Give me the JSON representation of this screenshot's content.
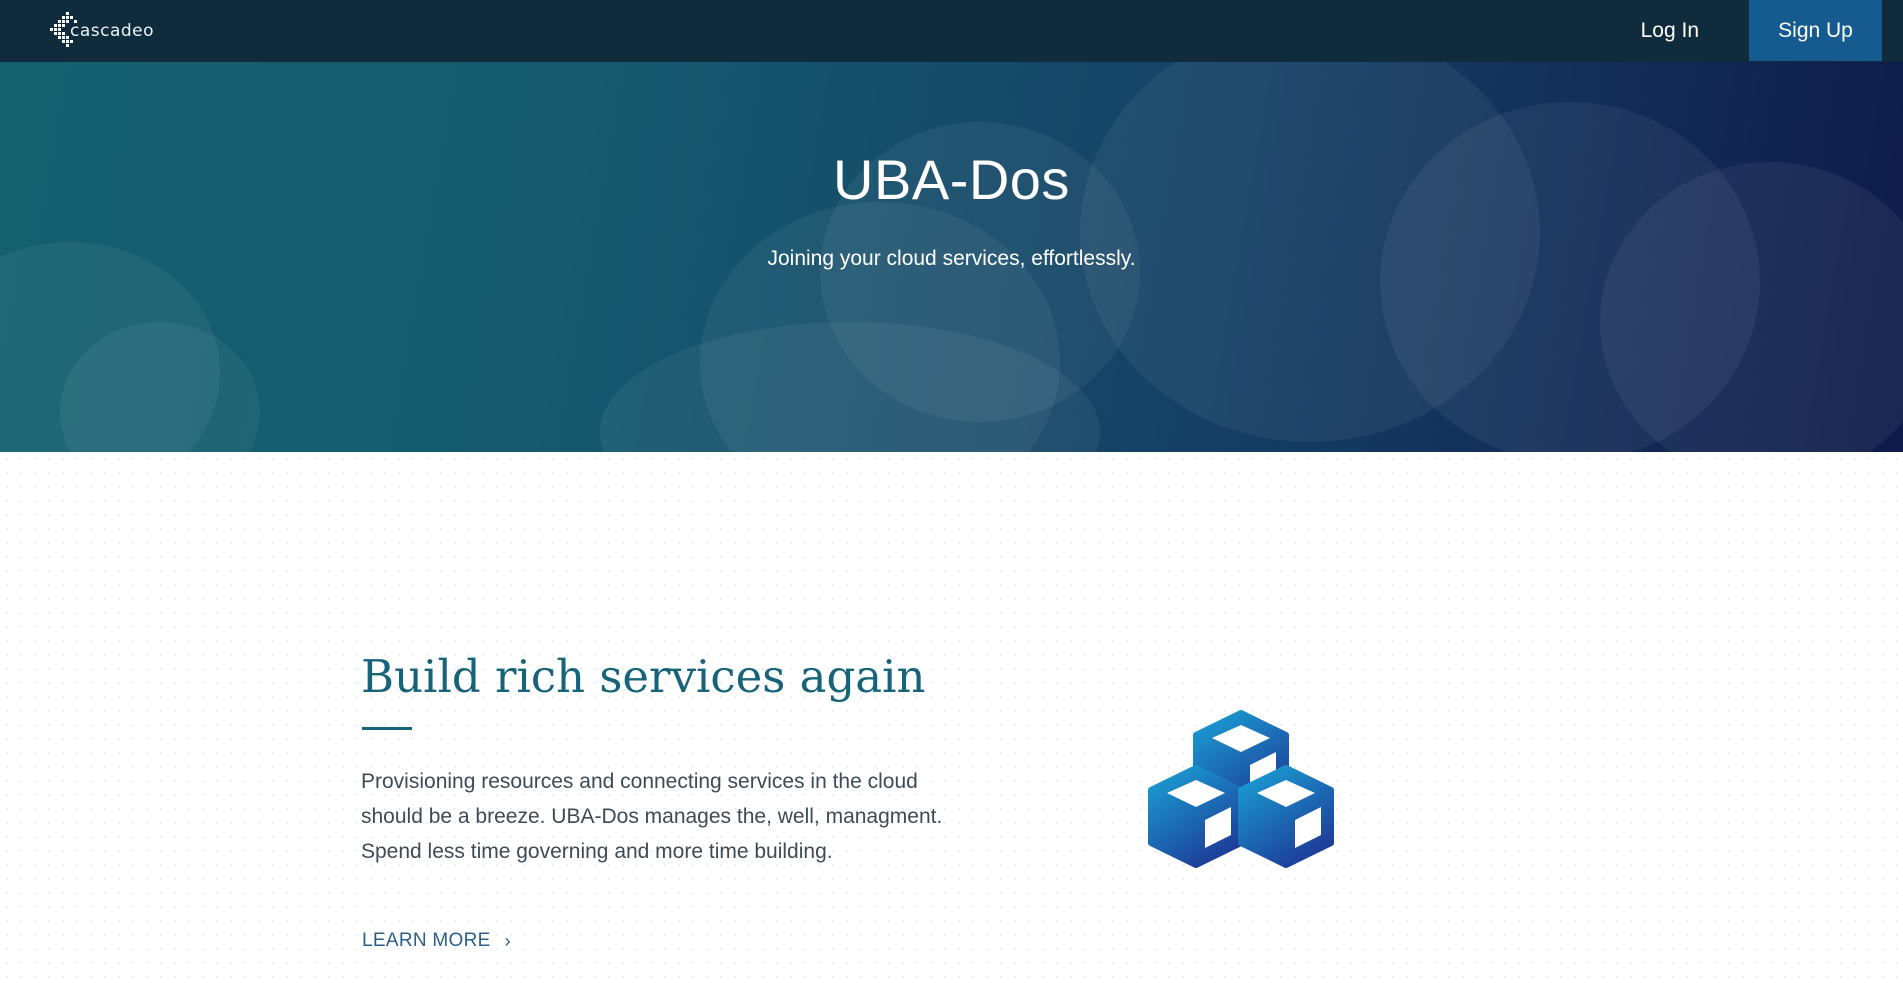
{
  "nav": {
    "logo_text": "cascadeo",
    "login_label": "Log In",
    "signup_label": "Sign Up"
  },
  "hero": {
    "title": "UBA-Dos",
    "subtitle": "Joining your cloud services, effortlessly."
  },
  "feature": {
    "heading": "Build rich services again",
    "body": "Provisioning resources and connecting services in the cloud should be a breeze. UBA-Dos manages the, well, managment. Spend less time governing and more time building.",
    "link_label": "LEARN MORE",
    "link_chevron": "›",
    "illustration": "cubes-icon"
  },
  "colors": {
    "nav_bg": "#102b3b",
    "signup_bg": "#165b8f",
    "heading": "#17637a",
    "body_text": "#3d4b57",
    "link": "#2b5f8a",
    "cube_light": "#1aa3d6",
    "cube_dark": "#1d3f9a"
  }
}
